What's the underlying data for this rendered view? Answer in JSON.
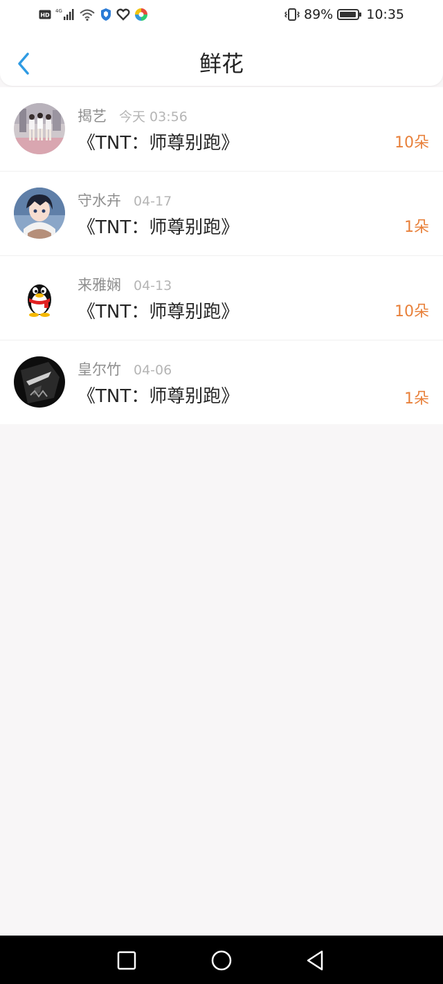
{
  "status_bar": {
    "battery": "89%",
    "time": "10:35"
  },
  "header": {
    "title": "鲜花"
  },
  "records": [
    {
      "name": "揭艺",
      "time": "今天 03:56",
      "book": "《TNT：师尊别跑》",
      "count": "10朵",
      "avatar": "photo-avatar"
    },
    {
      "name": "守水卉",
      "time": "04-17",
      "book": "《TNT：师尊别跑》",
      "count": "1朵",
      "avatar": "anime-avatar"
    },
    {
      "name": "来雅娴",
      "time": "04-13",
      "book": "《TNT：师尊别跑》",
      "count": "10朵",
      "avatar": "qq-penguin-avatar"
    },
    {
      "name": "皇尔竹",
      "time": "04-06",
      "book": "《TNT：师尊别跑》",
      "count": "1朵",
      "avatar": "dark-avatar"
    }
  ],
  "colors": {
    "accent": "#2f9be3",
    "count": "#e8803a",
    "background": "#f8f6f7"
  }
}
